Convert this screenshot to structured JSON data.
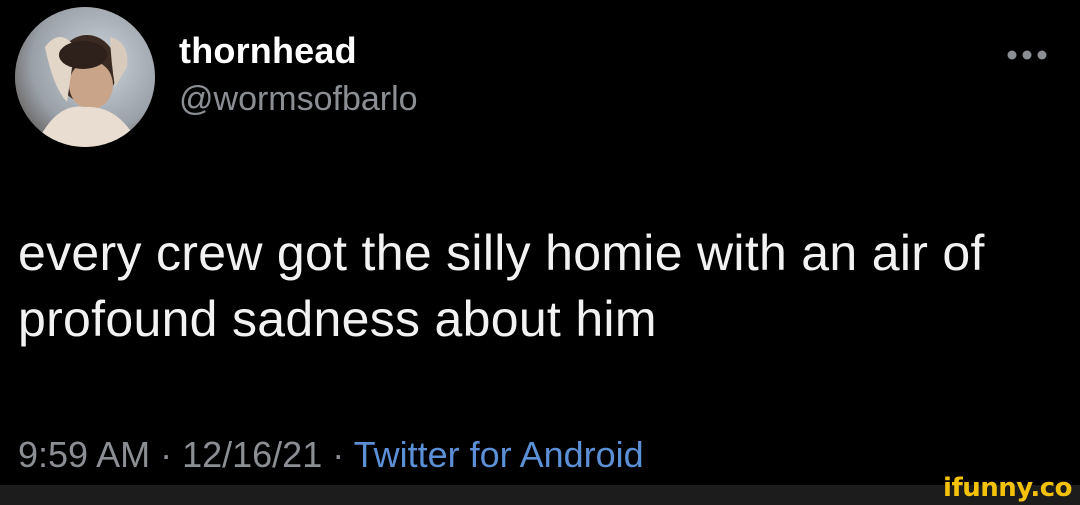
{
  "tweet": {
    "display_name": "thornhead",
    "handle": "@wormsofbarlo",
    "text": "every crew got the silly homie with an air of profound sadness about him",
    "time": "9:59 AM",
    "separator": " · ",
    "date": "12/16/21",
    "source": "Twitter for Android",
    "more_icon": "more-horizontal-icon"
  },
  "watermark": {
    "text": "ifunny.co"
  },
  "colors": {
    "background": "#000000",
    "name": "#ffffff",
    "secondary": "#8b8f94",
    "link": "#5b8fd6",
    "watermark": "#f5c20b"
  }
}
